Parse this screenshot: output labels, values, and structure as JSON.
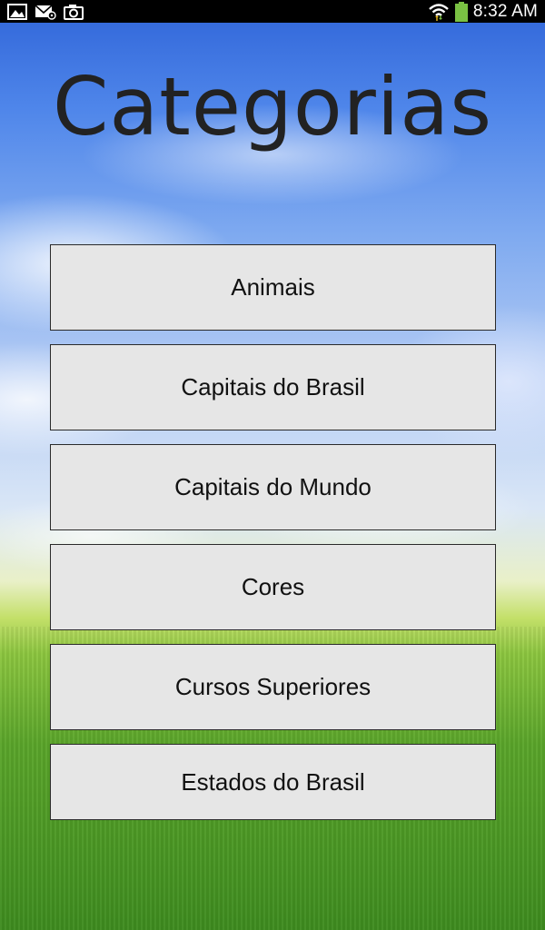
{
  "status_bar": {
    "time": "8:32 AM",
    "left_icons": [
      "image-icon",
      "email-icon",
      "camera-icon"
    ],
    "right_icons": [
      "wifi-icon",
      "battery-icon"
    ],
    "battery_color": "#7ac143"
  },
  "title": "Categorias",
  "categories": [
    {
      "label": "Animais"
    },
    {
      "label": "Capitais do Brasil"
    },
    {
      "label": "Capitais do Mundo"
    },
    {
      "label": "Cores"
    },
    {
      "label": "Cursos Superiores"
    },
    {
      "label": "Estados do Brasil"
    }
  ]
}
